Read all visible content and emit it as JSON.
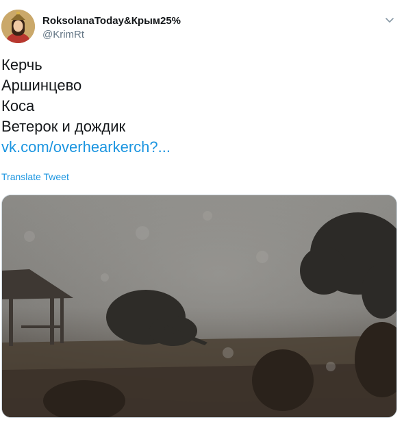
{
  "author": {
    "display_name": "RoksolanaToday&Крым25%",
    "handle": "@KrimRt",
    "avatar_icon": "avatar-portrait"
  },
  "tweet": {
    "lines": [
      "Керчь",
      "Аршинцево",
      "Коса",
      "Ветерок и дождик"
    ],
    "link_text": "vk.com/overhearkerch?...",
    "translate_label": "Translate Tweet"
  },
  "icons": {
    "menu": "chevron-down-icon"
  },
  "colors": {
    "link": "#1b95e0",
    "secondary_text": "#657786",
    "primary_text": "#14171a"
  }
}
